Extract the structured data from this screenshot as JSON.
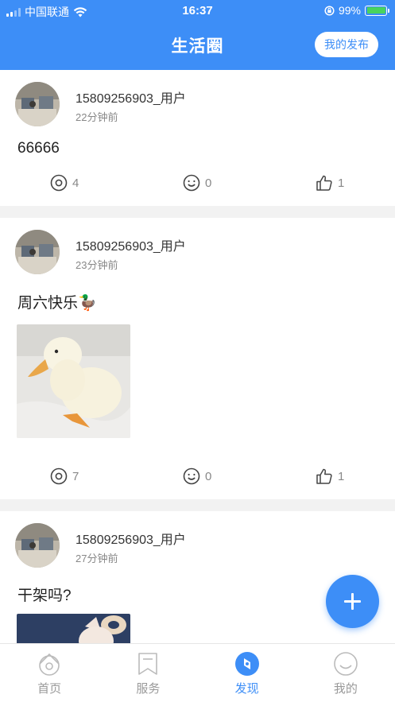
{
  "status_bar": {
    "carrier": "中国联通",
    "time": "16:37",
    "battery": "99%"
  },
  "header": {
    "title": "生活圈",
    "my_posts_label": "我的发布"
  },
  "posts": [
    {
      "username": "15809256903_用户",
      "time_ago": "22分钟前",
      "content": "66666",
      "views": "4",
      "comments": "0",
      "likes": "1"
    },
    {
      "username": "15809256903_用户",
      "time_ago": "23分钟前",
      "content": "周六快乐🦆",
      "views": "7",
      "comments": "0",
      "likes": "1"
    },
    {
      "username": "15809256903_用户",
      "time_ago": "27分钟前",
      "content": "干架吗?"
    }
  ],
  "tabs": [
    {
      "label": "首页",
      "icon": "home-icon"
    },
    {
      "label": "服务",
      "icon": "bookmark-icon"
    },
    {
      "label": "发现",
      "icon": "compass-icon"
    },
    {
      "label": "我的",
      "icon": "smile-profile-icon"
    }
  ],
  "colors": {
    "accent": "#3d8ef7",
    "background": "#f2f2f2",
    "battery_fill": "#49d35d"
  }
}
